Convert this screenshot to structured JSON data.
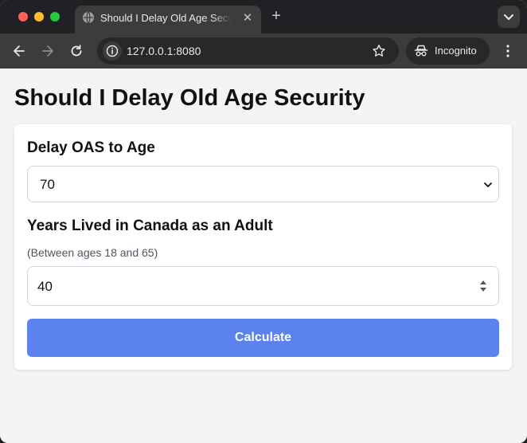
{
  "browser": {
    "tab_title": "Should I Delay Old Age Security",
    "new_tab_symbol": "+",
    "close_symbol": "✕",
    "url": "127.0.0.1:8080",
    "profile_label": "Incognito"
  },
  "page": {
    "title": "Should I Delay Old Age Security",
    "delay_field": {
      "label": "Delay OAS to Age",
      "selected_value": "70"
    },
    "years_field": {
      "label": "Years Lived in Canada as an Adult",
      "hint": "(Between ages 18 and 65)",
      "value": "40"
    },
    "calculate_label": "Calculate"
  },
  "colors": {
    "button_accent": "#5b82ee",
    "page_background": "#f3f4f6"
  }
}
